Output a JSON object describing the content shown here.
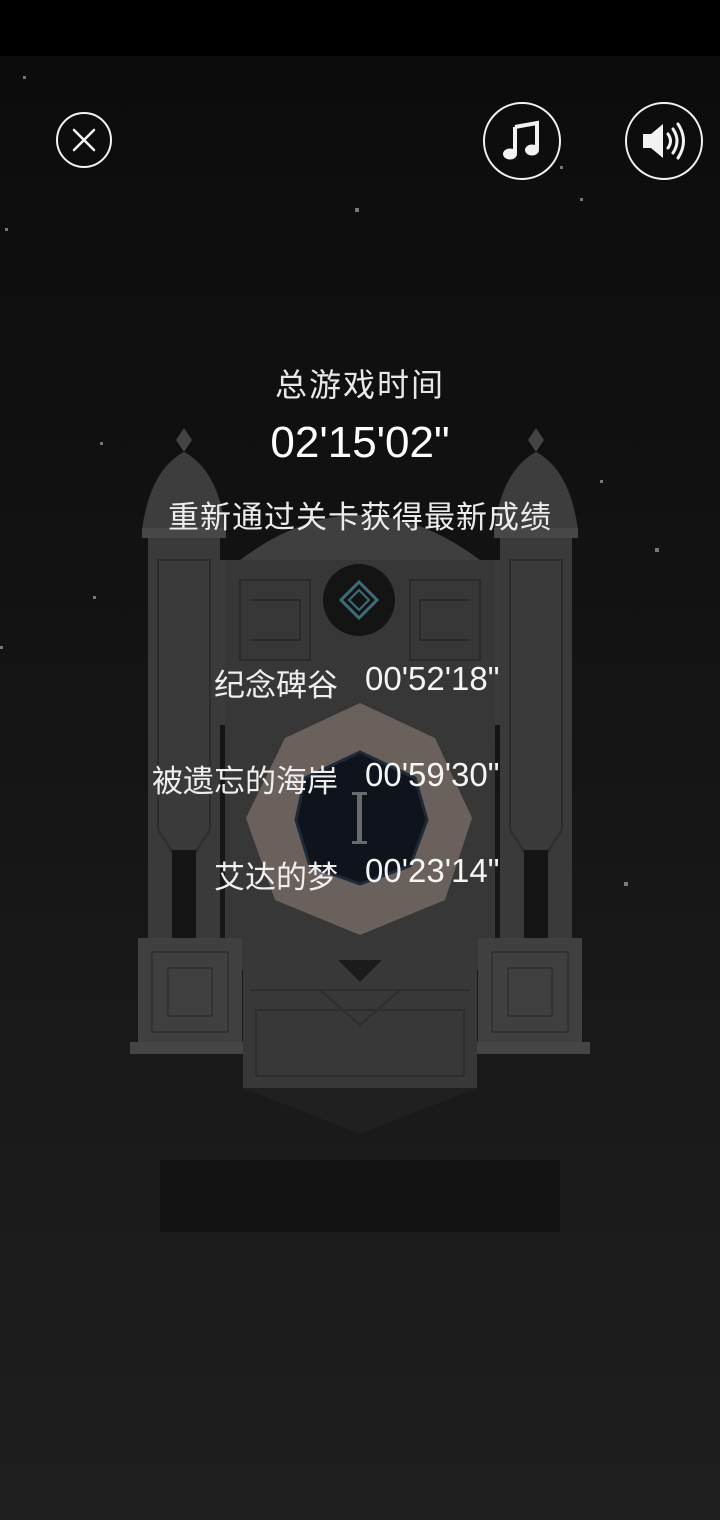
{
  "header": {
    "close_icon": "close-circle-icon",
    "music_icon": "music-note-icon",
    "sound_icon": "speaker-icon"
  },
  "summary": {
    "title": "总游戏时间",
    "total_time": "02'15'02\"",
    "hint": "重新通过关卡获得最新成绩"
  },
  "levels": [
    {
      "name": "纪念碑谷",
      "time": "00'52'18\""
    },
    {
      "name": "被遗忘的海岸",
      "time": "00'59'30\""
    },
    {
      "name": "艾达的梦",
      "time": "00'23'14\""
    }
  ],
  "colors": {
    "background": "#1a1a1a",
    "monument": "#3a3a3a",
    "gem_center": "#0d1118",
    "text": "#ffffff"
  }
}
